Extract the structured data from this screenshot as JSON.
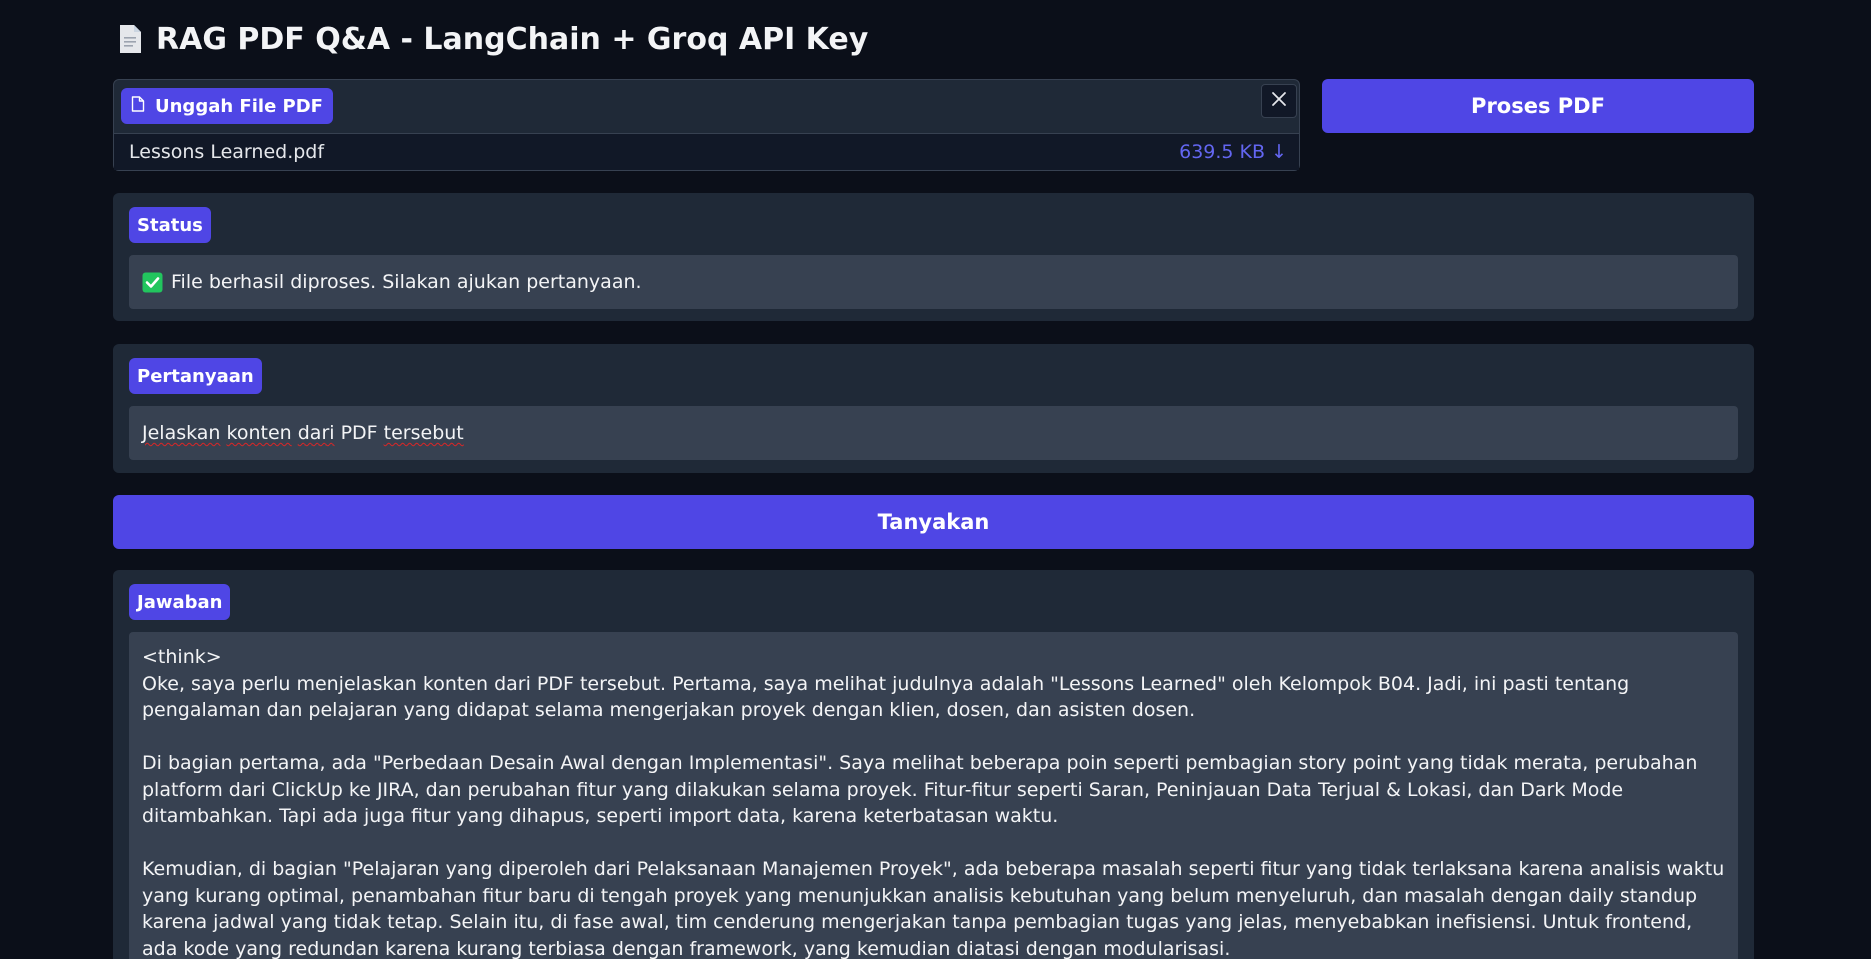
{
  "header": {
    "title": "RAG PDF Q&A - LangChain + Groq API Key",
    "icon": "document-icon"
  },
  "upload": {
    "label": "Unggah File PDF",
    "file_name": "Lessons Learned.pdf",
    "file_size": "639.5 KB ↓"
  },
  "actions": {
    "process_label": "Proses PDF",
    "ask_label": "Tanyakan"
  },
  "status": {
    "label": "Status",
    "message": "File berhasil diproses. Silakan ajukan pertanyaan."
  },
  "question": {
    "label": "Pertanyaan",
    "value_words": [
      "Jelaskan",
      " ",
      "konten",
      " ",
      "dari",
      " PDF ",
      "tersebut"
    ]
  },
  "answer": {
    "label": "Jawaban",
    "think_tag": "<think>",
    "paragraphs": [
      "Oke, saya perlu menjelaskan konten dari PDF tersebut. Pertama, saya melihat judulnya adalah \"Lessons Learned\" oleh Kelompok B04. Jadi, ini pasti tentang pengalaman dan pelajaran yang didapat selama mengerjakan proyek dengan klien, dosen, dan asisten dosen.",
      "Di bagian pertama, ada \"Perbedaan Desain Awal dengan Implementasi\". Saya melihat beberapa poin seperti pembagian story point yang tidak merata, perubahan platform dari ClickUp ke JIRA, dan perubahan fitur yang dilakukan selama proyek. Fitur-fitur seperti Saran, Peninjauan Data Terjual & Lokasi, dan Dark Mode ditambahkan. Tapi ada juga fitur yang dihapus, seperti import data, karena keterbatasan waktu.",
      "Kemudian, di bagian \"Pelajaran yang diperoleh dari Pelaksanaan Manajemen Proyek\", ada beberapa masalah seperti fitur yang tidak terlaksana karena analisis waktu yang kurang optimal, penambahan fitur baru di tengah proyek yang menunjukkan analisis kebutuhan yang belum menyeluruh, dan masalah dengan daily standup karena jadwal yang tidak tetap. Selain itu, di fase awal, tim cenderung mengerjakan tanpa pembagian tugas yang jelas, menyebabkan inefisiensi. Untuk frontend, ada kode yang redundan karena kurang terbiasa dengan framework, yang kemudian diatasi dengan modularisasi."
    ]
  },
  "colors": {
    "accent": "#4f46e5",
    "background": "#0b0f19",
    "panel": "#1f2937",
    "field": "#374151",
    "file_size": "#6366f1"
  }
}
